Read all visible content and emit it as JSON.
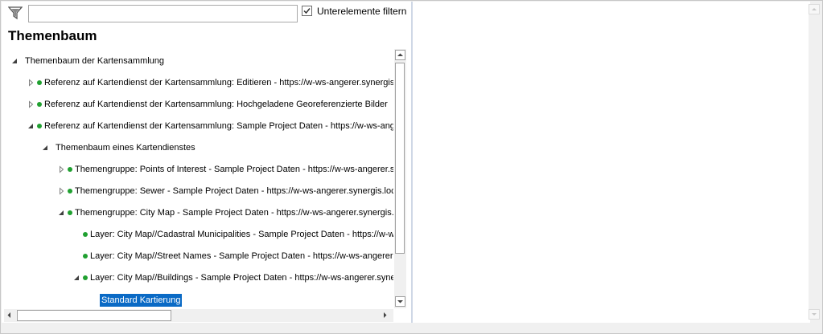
{
  "filter": {
    "placeholder": "",
    "value": "",
    "checkbox_label": "Unterelemente filtern",
    "checked": true
  },
  "panel_title": "Themenbaum",
  "tree": [
    {
      "label": "Themenbaum der Kartensammlung",
      "level": 0,
      "state": "expanded",
      "dot": false
    },
    {
      "label": "Referenz auf Kartendienst der Kartensammlung: Editieren - https://w-ws-angerer.synergis.local/Arcgis/rest/services",
      "level": 1,
      "state": "collapsed",
      "dot": true
    },
    {
      "label": "Referenz auf Kartendienst der Kartensammlung: Hochgeladene Georeferenzierte Bilder",
      "level": 1,
      "state": "collapsed",
      "dot": true
    },
    {
      "label": "Referenz auf Kartendienst der Kartensammlung: Sample Project Daten - https://w-ws-angerer.synergis.local",
      "level": 1,
      "state": "expanded",
      "dot": true
    },
    {
      "label": "Themenbaum eines Kartendienstes",
      "level": 2,
      "state": "expanded",
      "dot": false
    },
    {
      "label": "Themengruppe: Points of Interest - Sample Project Daten - https://w-ws-angerer.synergis.local",
      "level": 3,
      "state": "collapsed",
      "dot": true
    },
    {
      "label": "Themengruppe: Sewer - Sample Project Daten - https://w-ws-angerer.synergis.local",
      "level": 3,
      "state": "collapsed",
      "dot": true
    },
    {
      "label": "Themengruppe: City Map - Sample Project Daten - https://w-ws-angerer.synergis.local",
      "level": 3,
      "state": "expanded",
      "dot": true
    },
    {
      "label": "Layer: City Map//Cadastral Municipalities - Sample Project Daten - https://w-ws-angerer.synergis.local",
      "level": 4,
      "state": "leaf",
      "dot": true
    },
    {
      "label": "Layer: City Map//Street Names - Sample Project Daten - https://w-ws-angerer.synergis.local",
      "level": 4,
      "state": "leaf",
      "dot": true
    },
    {
      "label": "Layer: City Map//Buildings - Sample Project Daten - https://w-ws-angerer.synergis.local",
      "level": 4,
      "state": "expanded",
      "dot": true
    },
    {
      "label": "Standard Kartierung",
      "level": 5,
      "state": "selected",
      "dot": false
    }
  ],
  "icons": {
    "filter": "filter-funnel-icon",
    "expanded": "triangle-expanded-icon",
    "collapsed": "triangle-collapsed-icon",
    "status": "green-dot-icon"
  },
  "colors": {
    "selection": "#0a6ac5",
    "status_dot": "#20a030"
  }
}
